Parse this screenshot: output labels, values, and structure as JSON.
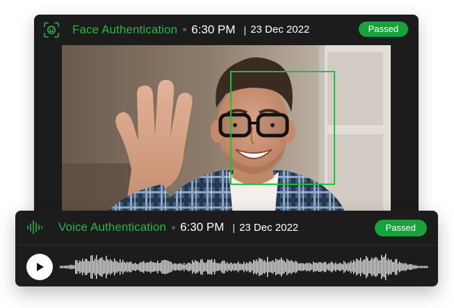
{
  "face_auth": {
    "icon": "face-scan-icon",
    "title": "Face Authentication",
    "time": "6:30 PM",
    "separator": "|",
    "date": "23 Dec 2022",
    "status": "Passed"
  },
  "voice_auth": {
    "icon": "soundwave-icon",
    "title": "Voice Authentication",
    "time": "6:30 PM",
    "separator": "|",
    "date": "23 Dec 2022",
    "status": "Passed",
    "play_icon": "play-icon"
  },
  "colors": {
    "accent_green": "#27b84a",
    "badge_green": "#17a23d",
    "card_background": "#1c1c1c",
    "waveform": "#e6e6e6"
  }
}
